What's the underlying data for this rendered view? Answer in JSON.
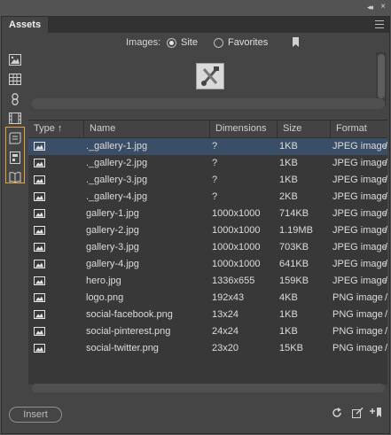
{
  "window": {
    "collapse_glyph": "◂◂",
    "close_glyph": "×"
  },
  "panel": {
    "tab_label": "Assets"
  },
  "sidebar": {
    "items": [
      {
        "name": "images-category",
        "icon": "image-icon"
      },
      {
        "name": "colors-category",
        "icon": "grid-icon"
      },
      {
        "name": "urls-category",
        "icon": "link-icon"
      },
      {
        "name": "media-category",
        "icon": "film-icon"
      },
      {
        "name": "scripts-category",
        "icon": "script-icon"
      },
      {
        "name": "templates-category",
        "icon": "template-icon"
      },
      {
        "name": "library-category",
        "icon": "library-icon"
      }
    ],
    "highlight_color": "#e8a33c"
  },
  "filter": {
    "label": "Images:",
    "options": [
      {
        "label": "Site",
        "selected": true
      },
      {
        "label": "Favorites",
        "selected": false
      }
    ]
  },
  "table": {
    "columns": [
      "Type",
      "Name",
      "Dimensions",
      "Size",
      "Format"
    ],
    "sort_glyph": "↑",
    "rows": [
      {
        "name": "._gallery-1.jpg",
        "dimensions": "?",
        "size": "1KB",
        "format": "JPEG image",
        "selected": true
      },
      {
        "name": "._gallery-2.jpg",
        "dimensions": "?",
        "size": "1KB",
        "format": "JPEG image"
      },
      {
        "name": "._gallery-3.jpg",
        "dimensions": "?",
        "size": "1KB",
        "format": "JPEG image"
      },
      {
        "name": "._gallery-4.jpg",
        "dimensions": "?",
        "size": "2KB",
        "format": "JPEG image"
      },
      {
        "name": "gallery-1.jpg",
        "dimensions": "1000x1000",
        "size": "714KB",
        "format": "JPEG image"
      },
      {
        "name": "gallery-2.jpg",
        "dimensions": "1000x1000",
        "size": "1.19MB",
        "format": "JPEG image"
      },
      {
        "name": "gallery-3.jpg",
        "dimensions": "1000x1000",
        "size": "703KB",
        "format": "JPEG image"
      },
      {
        "name": "gallery-4.jpg",
        "dimensions": "1000x1000",
        "size": "641KB",
        "format": "JPEG image"
      },
      {
        "name": "hero.jpg",
        "dimensions": "1336x655",
        "size": "159KB",
        "format": "JPEG image"
      },
      {
        "name": "logo.png",
        "dimensions": "192x43",
        "size": "4KB",
        "format": "PNG image"
      },
      {
        "name": "social-facebook.png",
        "dimensions": "13x24",
        "size": "1KB",
        "format": "PNG image"
      },
      {
        "name": "social-pinterest.png",
        "dimensions": "24x24",
        "size": "1KB",
        "format": "PNG image"
      },
      {
        "name": "social-twitter.png",
        "dimensions": "23x20",
        "size": "15KB",
        "format": "PNG image"
      }
    ],
    "trailing_glyph": "/"
  },
  "footer": {
    "insert_label": "Insert"
  },
  "colors": {
    "selection": "#3a4f67",
    "panel_bg": "#454545",
    "table_bg": "#383838"
  }
}
